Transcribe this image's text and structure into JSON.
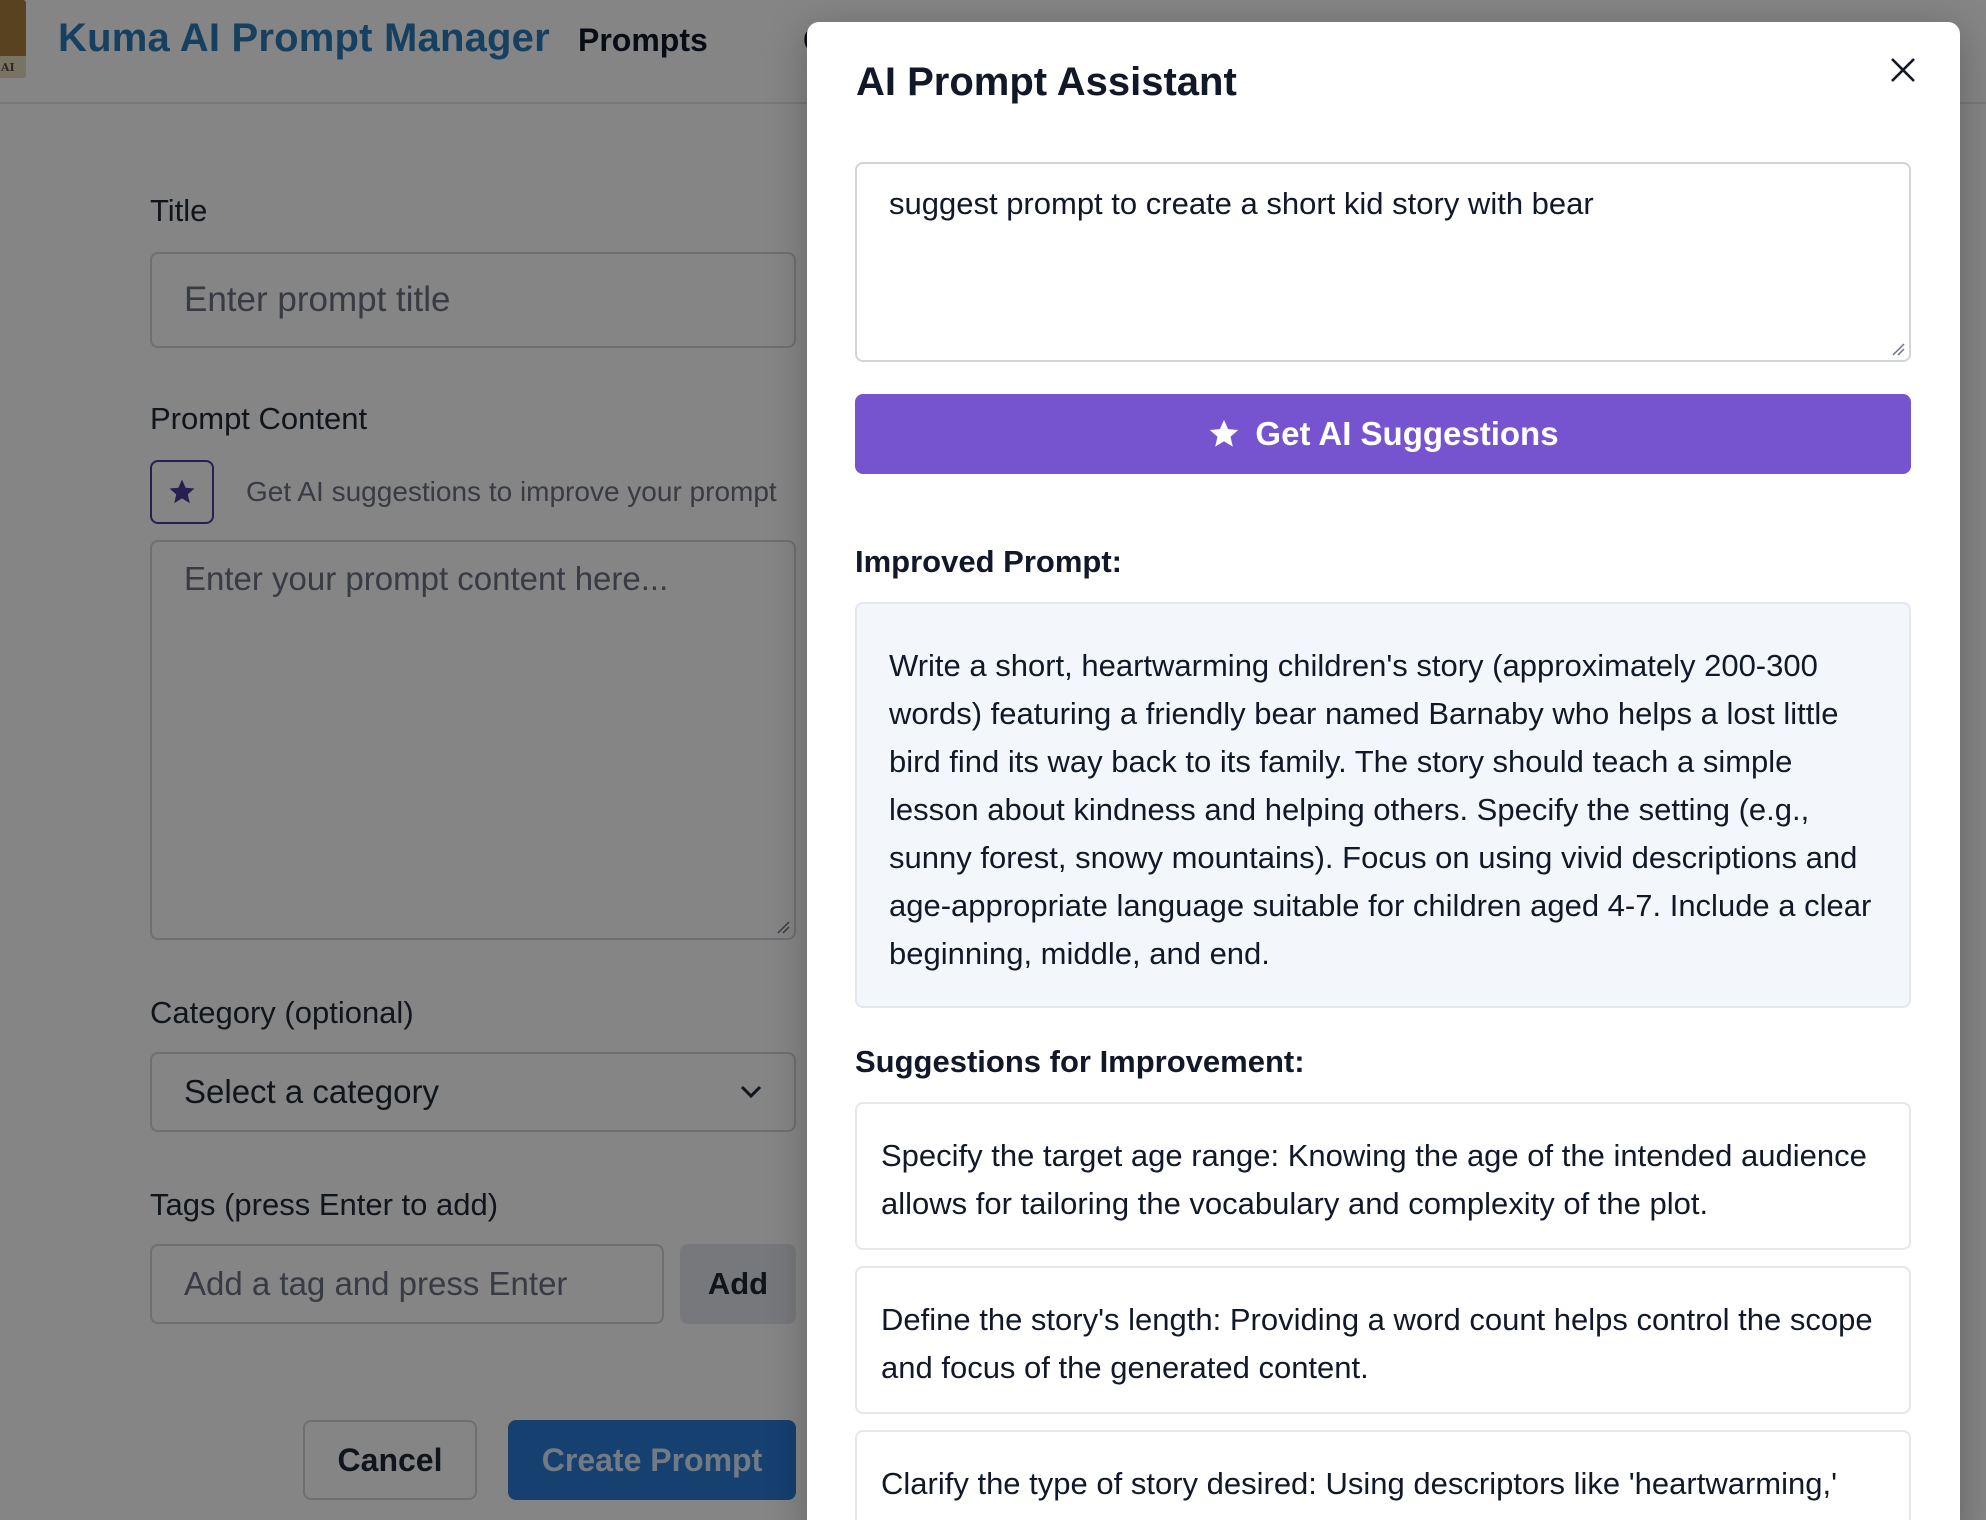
{
  "app": {
    "logo_text": "AI",
    "brand": "Kuma AI Prompt Manager",
    "nav": {
      "prompts": "Prompts",
      "next_partial": "C"
    }
  },
  "form": {
    "title_label": "Title",
    "title_placeholder": "Enter prompt title",
    "content_label": "Prompt Content",
    "ai_hint": "Get AI suggestions to improve your prompt",
    "content_placeholder": "Enter your prompt content here...",
    "category_label": "Category (optional)",
    "category_value": "Select a category",
    "tags_label": "Tags (press Enter to add)",
    "tags_placeholder": "Add a tag and press Enter",
    "add_label": "Add",
    "cancel_label": "Cancel",
    "create_label": "Create Prompt"
  },
  "modal": {
    "title": "AI Prompt Assistant",
    "input_value": "suggest prompt to create a short kid story with bear",
    "button_label": "Get AI Suggestions",
    "improved_heading": "Improved Prompt:",
    "improved_text": "Write a short, heartwarming children's story (approximately 200-300 words) featuring a friendly bear named Barnaby who helps a lost little bird find its way back to its family. The story should teach a simple lesson about kindness and helping others. Specify the setting (e.g., sunny forest, snowy mountains). Focus on using vivid descriptions and age-appropriate language suitable for children aged 4-7. Include a clear beginning, middle, and end.",
    "suggestions_heading": "Suggestions for Improvement:",
    "suggestions": [
      "Specify the target age range: Knowing the age of the intended audience allows for tailoring the vocabulary and complexity of the plot.",
      "Define the story's length: Providing a word count helps control the scope and focus of the generated content.",
      "Clarify the type of story desired: Using descriptors like 'heartwarming,'"
    ]
  },
  "icons": {
    "star": "star-icon",
    "close": "close-icon",
    "chevron": "chevron-down-icon"
  },
  "colors": {
    "brand": "#2b7bb9",
    "accent_purple": "#7654cf",
    "primary_blue": "#2b7bd6"
  }
}
